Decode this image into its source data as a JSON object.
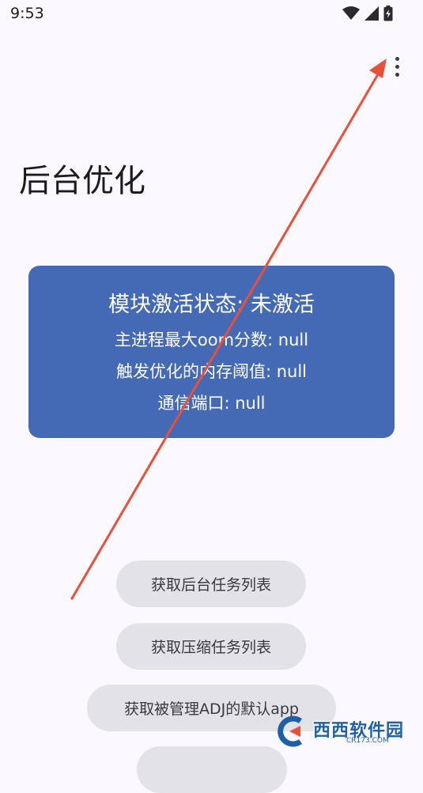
{
  "status_bar": {
    "time": "9:53"
  },
  "page": {
    "title": "后台优化"
  },
  "status_card": {
    "module_status": "模块激活状态: 未激活",
    "oom_score": "主进程最大oom分数: null",
    "memory_threshold": "触发优化的内存阈值: null",
    "port": "通信端口: null",
    "background_color": "#4469b5"
  },
  "actions": {
    "get_background_tasks": "获取后台任务列表",
    "get_compress_tasks": "获取压缩任务列表",
    "get_adj_default_apps": "获取被管理ADJ的默认app"
  },
  "icons": {
    "wifi": "wifi-icon",
    "signal": "signal-icon",
    "battery": "battery-charging-icon",
    "overflow": "more-vert-icon"
  },
  "watermark": {
    "brand": "西西软件园",
    "site": "CR173.COM"
  },
  "colors": {
    "background": "#fbf8fe",
    "button": "#e3e2e6",
    "annotation_arrow": "#e8503a"
  }
}
